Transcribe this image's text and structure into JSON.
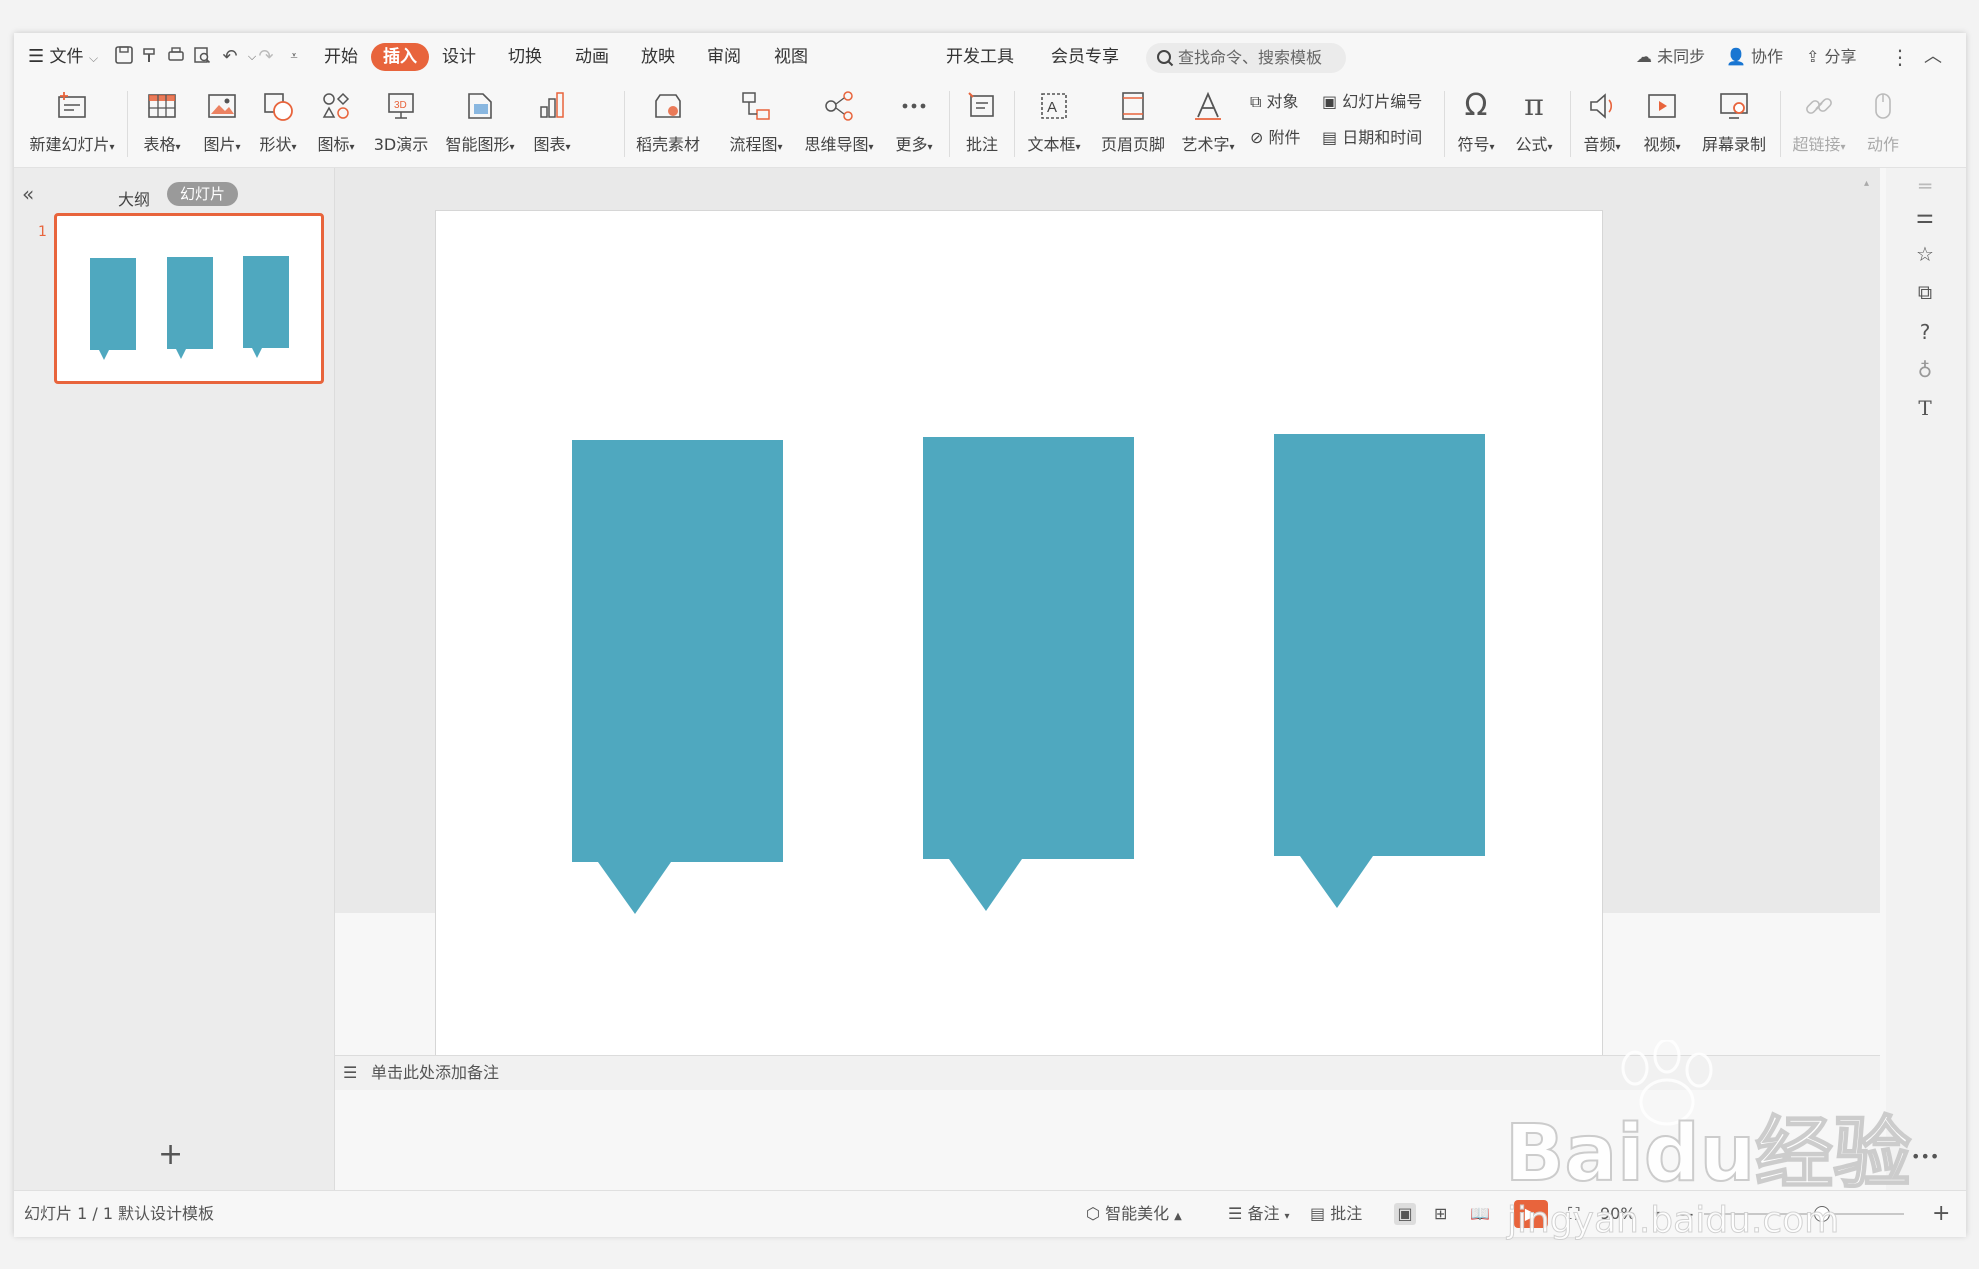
{
  "menubar": {
    "file_menu": "文件",
    "tabs": [
      {
        "label": "开始",
        "active": false
      },
      {
        "label": "插入",
        "active": true
      },
      {
        "label": "设计",
        "active": false
      },
      {
        "label": "切换",
        "active": false
      },
      {
        "label": "动画",
        "active": false
      },
      {
        "label": "放映",
        "active": false
      },
      {
        "label": "审阅",
        "active": false
      },
      {
        "label": "视图",
        "active": false
      },
      {
        "label": "开发工具",
        "active": false
      },
      {
        "label": "会员专享",
        "active": false
      }
    ],
    "search_placeholder": "查找命令、搜索模板",
    "sync": "未同步",
    "collab": "协作",
    "share": "分享"
  },
  "ribbon": {
    "buttons": [
      {
        "label": "新建幻灯片",
        "dropdown": true,
        "icon": "new-slide-icon"
      },
      {
        "label": "表格",
        "dropdown": true,
        "icon": "table-icon"
      },
      {
        "label": "图片",
        "dropdown": true,
        "icon": "picture-icon"
      },
      {
        "label": "形状",
        "dropdown": true,
        "icon": "shape-icon"
      },
      {
        "label": "图标",
        "dropdown": true,
        "icon": "icons-icon"
      },
      {
        "label": "3D演示",
        "dropdown": false,
        "icon": "3d-icon"
      },
      {
        "label": "智能图形",
        "dropdown": true,
        "icon": "smartart-icon"
      },
      {
        "label": "图表",
        "dropdown": true,
        "icon": "chart-icon"
      },
      {
        "label": "稻壳素材",
        "dropdown": false,
        "icon": "material-icon"
      },
      {
        "label": "流程图",
        "dropdown": true,
        "icon": "flowchart-icon"
      },
      {
        "label": "思维导图",
        "dropdown": true,
        "icon": "mindmap-icon"
      },
      {
        "label": "更多",
        "dropdown": true,
        "icon": "more-icon"
      },
      {
        "label": "批注",
        "dropdown": false,
        "icon": "comment-icon"
      },
      {
        "label": "文本框",
        "dropdown": true,
        "icon": "textbox-icon"
      },
      {
        "label": "页眉页脚",
        "dropdown": false,
        "icon": "header-footer-icon"
      },
      {
        "label": "艺术字",
        "dropdown": true,
        "icon": "wordart-icon"
      },
      {
        "label": "符号",
        "dropdown": true,
        "icon": "symbol-icon"
      },
      {
        "label": "公式",
        "dropdown": true,
        "icon": "formula-icon"
      },
      {
        "label": "音频",
        "dropdown": true,
        "icon": "audio-icon"
      },
      {
        "label": "视频",
        "dropdown": true,
        "icon": "video-icon"
      },
      {
        "label": "屏幕录制",
        "dropdown": false,
        "icon": "screen-record-icon"
      },
      {
        "label": "超链接",
        "dropdown": true,
        "icon": "hyperlink-icon",
        "disabled": true
      },
      {
        "label": "动作",
        "dropdown": false,
        "icon": "action-icon",
        "disabled": true
      }
    ],
    "small": {
      "object": "对象",
      "slide_number": "幻灯片编号",
      "attachment": "附件",
      "datetime": "日期和时间"
    }
  },
  "leftpanel": {
    "tab_outline": "大纲",
    "tab_slides": "幻灯片",
    "slide_index": "1"
  },
  "notes": {
    "placeholder": "单击此处添加备注"
  },
  "slide": {
    "shape_color": "#4fa8bf",
    "shape_count": 3
  },
  "status": {
    "slide_counter": "幻灯片 1 / 1",
    "template": "默认设计模板",
    "beautify": "智能美化",
    "notes": "备注",
    "comments": "批注",
    "zoom": "90%"
  },
  "watermark": {
    "brand": "Baidu经验",
    "url": "jingyan.baidu.com"
  },
  "colors": {
    "accent": "#e8643c",
    "shape": "#4fa8bf"
  }
}
